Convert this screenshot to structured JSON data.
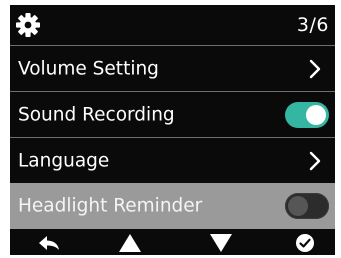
{
  "header": {
    "icon": "gear-icon",
    "page_indicator": "3/6"
  },
  "menu": {
    "items": [
      {
        "label": "Volume Setting",
        "control": "chevron-right-icon"
      },
      {
        "label": "Sound Recording",
        "control": "toggle",
        "toggle_on": true
      },
      {
        "label": "Language",
        "control": "chevron-right-icon"
      },
      {
        "label": "Headlight Reminder",
        "control": "toggle",
        "toggle_on": false,
        "highlighted": true
      }
    ]
  },
  "footer": {
    "buttons": [
      "back-arrow-icon",
      "up-triangle-icon",
      "down-triangle-icon",
      "confirm-check-icon"
    ]
  },
  "colors": {
    "background": "#0a0a0a",
    "text": "#ffffff",
    "toggle_on": "#35b6a3",
    "selected_row": "#9a9a9a"
  }
}
